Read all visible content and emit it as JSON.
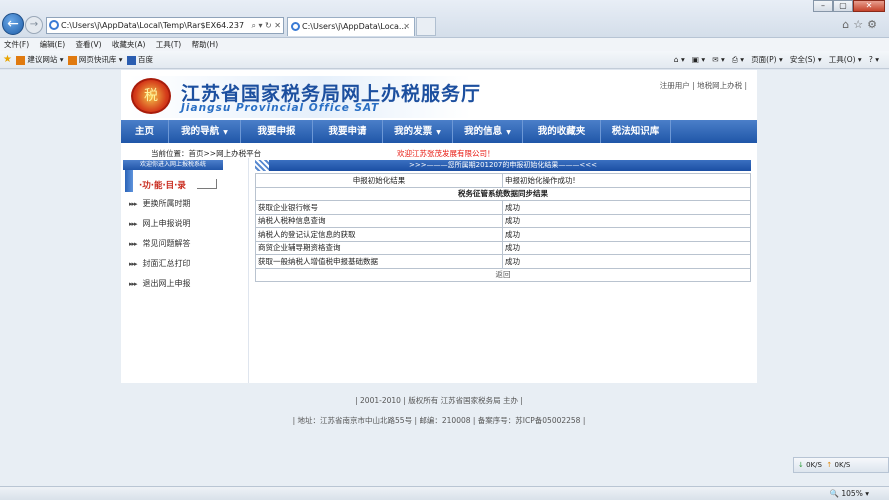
{
  "browser": {
    "address": "C:\\Users\\j\\AppData\\Local\\Temp\\Rar$EX64.237",
    "tab_title": "C:\\Users\\j\\AppData\\Loca...",
    "menu": [
      "文件(F)",
      "编辑(E)",
      "查看(V)",
      "收藏夹(A)",
      "工具(T)",
      "帮助(H)"
    ],
    "favorites": [
      "建议网站 ▾",
      "网页快讯库 ▾",
      "百度"
    ],
    "commands": [
      "页面(P) ▾",
      "安全(S) ▾",
      "工具(O) ▾"
    ],
    "zoom": "105%",
    "download_speed": "0K/S",
    "upload_speed": "0K/S"
  },
  "site": {
    "title": "江苏省国家税务局网上办税服务厅",
    "subtitle": "Jiangsu Provincial Office SAT",
    "top_links": "注册用户 | 地税网上办税 |",
    "nav": [
      {
        "label": "主页"
      },
      {
        "label": "我的导航",
        "arrow": "▼"
      },
      {
        "label": "我要申报"
      },
      {
        "label": "我要申请"
      },
      {
        "label": "我的发票",
        "arrow": "▼"
      },
      {
        "label": "我的信息",
        "arrow": "▼"
      },
      {
        "label": "我的收藏夹"
      },
      {
        "label": "税法知识库"
      }
    ],
    "location_label": "当前位置：",
    "location_home": "首页",
    "location_path": ">>网上办税平台",
    "welcome": "欢迎江苏张茂发展有限公司！"
  },
  "sidebar": {
    "header": "欢迎你进入网上报税系统",
    "func_title": "·功·能·目·录",
    "items": [
      "更换所属时期",
      "网上申报说明",
      "常见问题解答",
      "封面汇总打印",
      "退出网上申报"
    ]
  },
  "result": {
    "header": ">>>———您所属期201207的申报初始化结果———<<<",
    "init_label": "申报初始化结果",
    "init_value": "申报初始化操作成功!",
    "section": "税务征管系统数据同步结果",
    "rows": [
      {
        "name": "获取企业银行帐号",
        "status": "成功"
      },
      {
        "name": "纳税人税种信息查询",
        "status": "成功"
      },
      {
        "name": "纳税人的登记认定信息的获取",
        "status": "成功"
      },
      {
        "name": "商贸企业辅导期资格查询",
        "status": "成功"
      },
      {
        "name": "获取一般纳税人增值税申报基础数据",
        "status": "成功"
      }
    ],
    "back": "返回"
  },
  "footer": {
    "line1": "| 2001-2010 | 版权所有  江苏省国家税务局  主办  |",
    "line2": "| 地址：江苏省南京市中山北路55号 | 邮编：210008 | 备案序号：苏ICP备05002258 |"
  }
}
